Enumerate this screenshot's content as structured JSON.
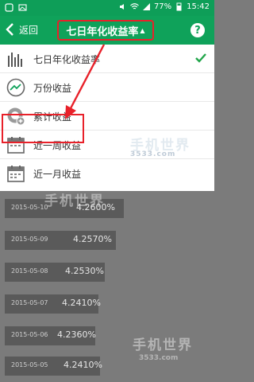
{
  "status_bar": {
    "battery": "77%",
    "time": "15:42"
  },
  "app_bar": {
    "back_label": "返回",
    "title": "七日年化收益率",
    "title_caret": "▲",
    "help": "?"
  },
  "menu": {
    "items": [
      {
        "label": "七日年化收益率",
        "icon": "bar-chart-icon",
        "selected": true
      },
      {
        "label": "万份收益",
        "icon": "trend-line-icon",
        "selected": false
      },
      {
        "label": "累计收益",
        "icon": "coin-plus-icon",
        "selected": false
      },
      {
        "label": "近一周收益",
        "icon": "calendar-week-icon",
        "selected": false
      },
      {
        "label": "近一月收益",
        "icon": "calendar-month-icon",
        "selected": false
      }
    ]
  },
  "watermark": {
    "title": "手机世界",
    "url": "3533.com"
  },
  "rows": [
    {
      "date": "2015-05-10",
      "value": "4.2600%"
    },
    {
      "date": "2015-05-09",
      "value": "4.2570%"
    },
    {
      "date": "2015-05-08",
      "value": "4.2530%"
    },
    {
      "date": "2015-05-07",
      "value": "4.2410%"
    },
    {
      "date": "2015-05-06",
      "value": "4.2360%"
    },
    {
      "date": "2015-05-05",
      "value": "4.2410%"
    }
  ],
  "colors": {
    "green": "#0fa25a",
    "red": "#e8212a"
  }
}
